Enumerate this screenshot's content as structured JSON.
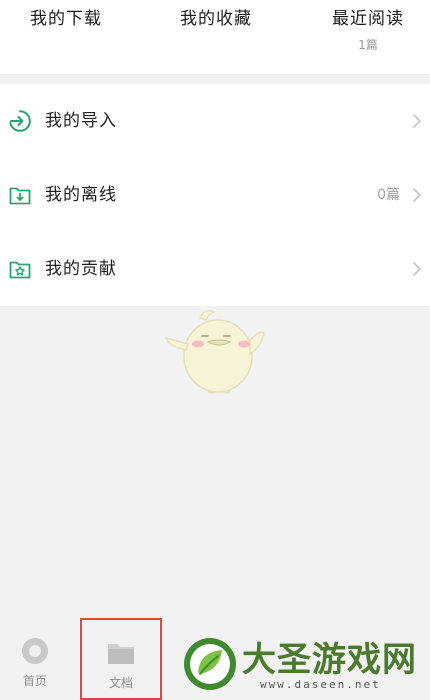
{
  "top_tabs": {
    "downloads": {
      "label": "我的下载"
    },
    "favorites": {
      "label": "我的收藏"
    },
    "recent": {
      "label": "最近阅读",
      "count": "1篇"
    }
  },
  "list": [
    {
      "label": "我的导入",
      "icon": "import-icon"
    },
    {
      "label": "我的离线",
      "icon": "offline-download-icon",
      "value": "0篇"
    },
    {
      "label": "我的贡献",
      "icon": "contribution-star-icon"
    }
  ],
  "bottom_nav": {
    "home": {
      "label": "首页",
      "icon": "home-icon"
    },
    "docs": {
      "label": "文档",
      "icon": "folder-icon",
      "selected": true
    }
  },
  "watermark": {
    "text": "大圣游戏网",
    "url": "www.daseen.net"
  },
  "colors": {
    "accent_green": "#2aa36f",
    "selected_border": "#d64a4a",
    "page_bg": "#f2f2f2"
  }
}
